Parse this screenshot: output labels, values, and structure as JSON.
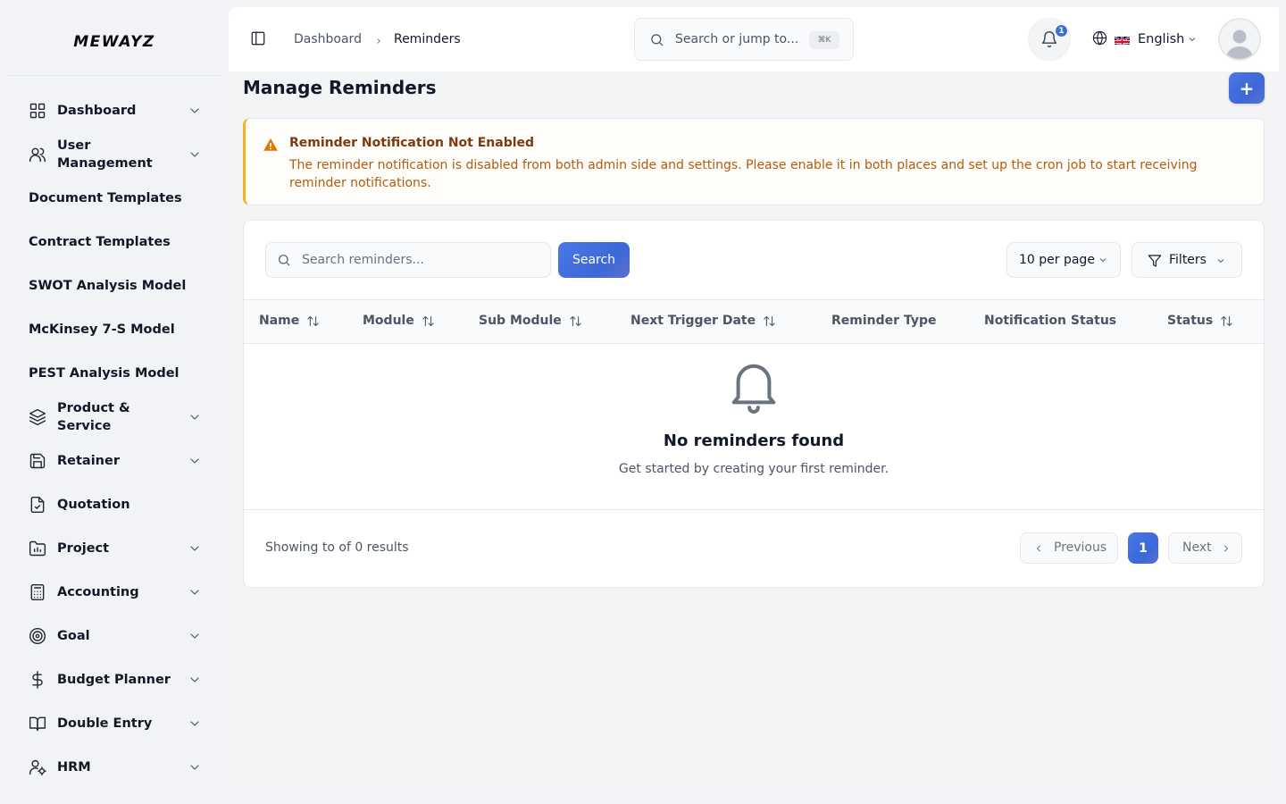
{
  "app": {
    "logo_text": "MEWAYZ"
  },
  "sidebar": {
    "items": [
      {
        "label": "Dashboard",
        "icon": "grid-icon",
        "has_chevron": true
      },
      {
        "label": "User Management",
        "icon": "users-icon",
        "has_chevron": true
      },
      {
        "label": "Document Templates",
        "icon": "",
        "has_chevron": false
      },
      {
        "label": "Contract Templates",
        "icon": "",
        "has_chevron": false
      },
      {
        "label": "SWOT Analysis Model",
        "icon": "",
        "has_chevron": false
      },
      {
        "label": "McKinsey 7-S Model",
        "icon": "",
        "has_chevron": false
      },
      {
        "label": "PEST Analysis Model",
        "icon": "",
        "has_chevron": false
      },
      {
        "label": "Product & Service",
        "icon": "layers-icon",
        "has_chevron": true
      },
      {
        "label": "Retainer",
        "icon": "save-icon",
        "has_chevron": true
      },
      {
        "label": "Quotation",
        "icon": "file-check-icon",
        "has_chevron": false
      },
      {
        "label": "Project",
        "icon": "folder-chart-icon",
        "has_chevron": true
      },
      {
        "label": "Accounting",
        "icon": "calculator-icon",
        "has_chevron": true
      },
      {
        "label": "Goal",
        "icon": "target-icon",
        "has_chevron": true
      },
      {
        "label": "Budget Planner",
        "icon": "dollar-icon",
        "has_chevron": true
      },
      {
        "label": "Double Entry",
        "icon": "book-icon",
        "has_chevron": true
      },
      {
        "label": "HRM",
        "icon": "user-cog-icon",
        "has_chevron": true
      }
    ]
  },
  "header": {
    "breadcrumb": [
      "Dashboard",
      "Reminders"
    ],
    "search_placeholder": "Search or jump to...",
    "search_shortcut": "⌘K",
    "notification_count": "1",
    "language": "English"
  },
  "page": {
    "title": "Manage Reminders",
    "add_label": "+"
  },
  "alert": {
    "title": "Reminder Notification Not Enabled",
    "message": "The reminder notification is disabled from both admin side and settings. Please enable it in both places and set up the cron job to start receiving reminder notifications.",
    "color": "#f0b429"
  },
  "table": {
    "search_placeholder": "Search reminders...",
    "search_button": "Search",
    "per_page": "10 per page",
    "filters_label": "Filters",
    "columns": [
      {
        "label": "Name",
        "sortable": true
      },
      {
        "label": "Module",
        "sortable": true
      },
      {
        "label": "Sub Module",
        "sortable": true
      },
      {
        "label": "Next Trigger Date",
        "sortable": true
      },
      {
        "label": "Reminder Type",
        "sortable": false
      },
      {
        "label": "Notification Status",
        "sortable": false
      },
      {
        "label": "Status",
        "sortable": true
      }
    ],
    "empty_title": "No reminders found",
    "empty_subtitle": "Get started by creating your first reminder.",
    "footer_info": "Showing to of 0 results",
    "pagination": {
      "previous": "Previous",
      "current": "1",
      "next": "Next"
    }
  },
  "colors": {
    "accent": "#3d68d8",
    "warning": "#b25c09"
  }
}
